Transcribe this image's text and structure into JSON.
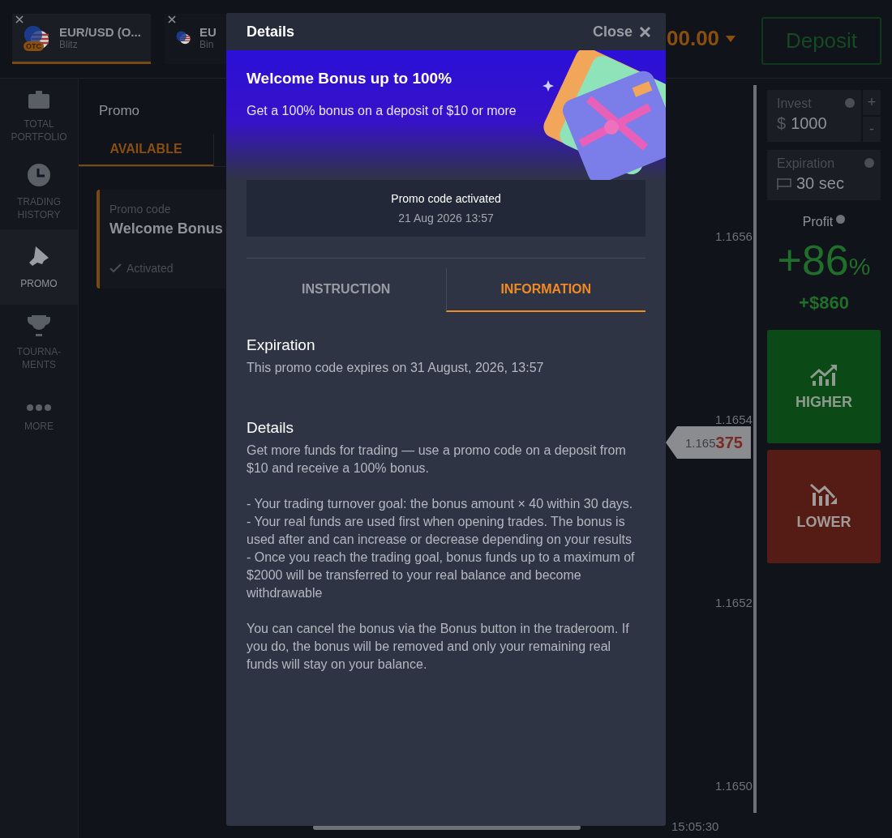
{
  "asset_tabs": [
    {
      "symbol": "EUR/USD (O...",
      "mode": "Blitz",
      "badge": "OTC",
      "selected": true
    },
    {
      "symbol": "EU",
      "mode": "Bin",
      "selected": false
    }
  ],
  "balance": "00.00",
  "deposit_button": "Deposit",
  "sidebar": {
    "items": [
      {
        "kind": "portfolio",
        "label": "TOTAL PORTFOLIO",
        "selected": false
      },
      {
        "kind": "history",
        "label": "TRADING HISTORY",
        "selected": false
      },
      {
        "kind": "promo",
        "label": "PROMO",
        "selected": true
      },
      {
        "kind": "tournaments",
        "label": "TOURNA-MENTS",
        "selected": false
      },
      {
        "kind": "more",
        "label": "MORE",
        "selected": false
      }
    ]
  },
  "promo_panel": {
    "title": "Promo",
    "tabs": [
      {
        "label": "AVAILABLE",
        "selected": true
      }
    ],
    "card": {
      "caption": "Promo code",
      "name": "Welcome Bonus",
      "status": "Activated"
    }
  },
  "chart": {
    "axis_labels": [
      "1.1656",
      "1.1654",
      "1.1652",
      "1.1650"
    ],
    "price_prefix": "1.165",
    "price_suffix": "375",
    "time_label": "15:05:30"
  },
  "trade_panel": {
    "invest": {
      "label": "Invest",
      "currency": "$",
      "value": "1000",
      "plus": "+",
      "minus": "-"
    },
    "expiration": {
      "label": "Expiration",
      "value": "30 sec"
    },
    "profit": {
      "label": "Profit",
      "percent": "+86",
      "percent_sign": "%",
      "amount": "+$860"
    },
    "buttons": [
      {
        "kind": "higher",
        "label": "HIGHER"
      },
      {
        "kind": "lower",
        "label": "LOWER"
      }
    ]
  },
  "modal": {
    "title": "Details",
    "close": "Close",
    "banner": {
      "title": "Welcome Bonus up to 100%",
      "subtitle": "Get a 100% bonus on a deposit of $10 or more"
    },
    "activation": {
      "title": "Promo code activated",
      "date": "21 Aug 2026 13:57"
    },
    "tabs": [
      {
        "label": "INSTRUCTION",
        "selected": false
      },
      {
        "label": "INFORMATION",
        "selected": true
      }
    ],
    "sections": [
      {
        "heading": "Expiration",
        "blocks": [
          [
            "This promo code expires on 31 August, 2026, 13:57"
          ]
        ]
      },
      {
        "heading": "Details",
        "blocks": [
          [
            "Get more funds for trading — use a promo code on a deposit from $10 and receive a 100% bonus."
          ],
          [
            "- Your trading turnover goal: the bonus amount × 40 within 30 days.",
            "- Your real funds are used first when opening trades. The bonus is used after and can increase or decrease depending on your results",
            "- Once you reach the trading goal, bonus funds up to a maximum of $2000 will be transferred to your real balance and become withdrawable"
          ],
          [
            "You can cancel the bonus via the Bonus button in the traderoom. If you do, the bonus will be removed and only your remaining real funds will stay on your balance."
          ]
        ]
      }
    ]
  }
}
